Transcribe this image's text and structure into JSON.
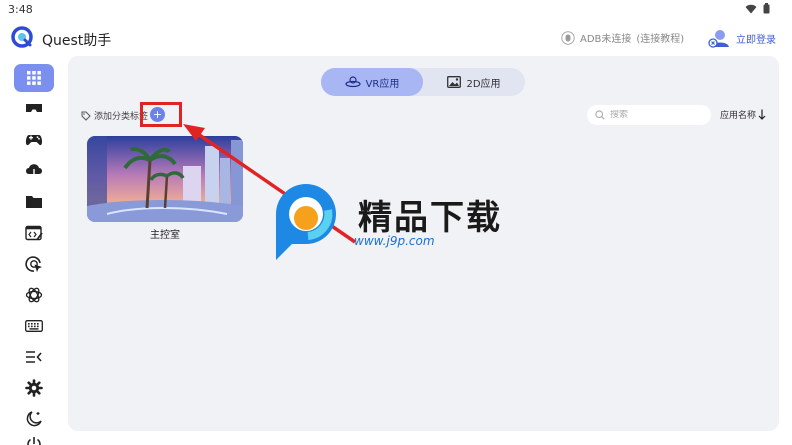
{
  "status_bar": {
    "time": "3:48"
  },
  "app": {
    "title": "Quest助手"
  },
  "header": {
    "adb_status": "ADB未连接",
    "adb_help": "(连接教程)",
    "login_label": "立即登录"
  },
  "sidebar": {
    "items": [
      {
        "icon": "grid-icon",
        "active": true
      },
      {
        "icon": "vr-headset-icon"
      },
      {
        "icon": "gamepad-icon"
      },
      {
        "icon": "cloud-download-icon"
      },
      {
        "icon": "folder-icon"
      },
      {
        "icon": "code-edit-icon"
      },
      {
        "icon": "cursor-target-icon"
      },
      {
        "icon": "openai-icon"
      },
      {
        "icon": "keyboard-icon"
      },
      {
        "icon": "collapse-menu-icon"
      },
      {
        "icon": "settings-gear-icon"
      },
      {
        "icon": "night-mode-icon"
      },
      {
        "icon": "power-icon"
      }
    ]
  },
  "tabs": [
    {
      "label": "VR应用",
      "active": true
    },
    {
      "label": "2D应用",
      "active": false
    }
  ],
  "toolbar": {
    "add_tag_label": "添加分类标签",
    "add_button": "+",
    "search_placeholder": "搜索",
    "sort_label": "应用名称"
  },
  "apps": [
    {
      "name": "主控室"
    }
  ],
  "watermark": {
    "title": "精品下载",
    "url": "www.j9p.com"
  },
  "colors": {
    "accent": "#6b82ec",
    "active_nav": "#7a8ff0",
    "link": "#3f5fd8",
    "annotation": "#e02424"
  }
}
